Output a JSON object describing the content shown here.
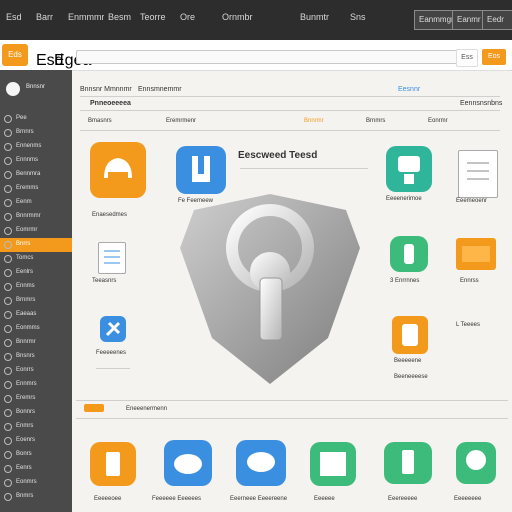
{
  "topbar": {
    "items": [
      "Esd",
      "Barr",
      "Enmmmr",
      "Besm",
      "Teorre",
      "Ore",
      "Ornmbr",
      "Bunmtr",
      "Sns"
    ],
    "buttons": [
      "Eanmmgr",
      "Eanmr",
      "Eedr"
    ]
  },
  "header": {
    "logo": "Eds",
    "link1": "Esd",
    "link2": "Egea",
    "search_value": "",
    "btn_ghost": "Ess",
    "btn_primary": "Eos"
  },
  "sidebar": {
    "username": "Bnnsnr",
    "items": [
      {
        "label": "Pee",
        "active": false
      },
      {
        "label": "Brnnrs",
        "active": false
      },
      {
        "label": "Ennenms",
        "active": false
      },
      {
        "label": "Ennnms",
        "active": false
      },
      {
        "label": "Bennmra",
        "active": false
      },
      {
        "label": "Eremms",
        "active": false
      },
      {
        "label": "Eenm",
        "active": false
      },
      {
        "label": "Bnnrmmr",
        "active": false
      },
      {
        "label": "Eomrmr",
        "active": false
      },
      {
        "label": "Bnrrs",
        "active": true
      },
      {
        "label": "Tomcs",
        "active": false
      },
      {
        "label": "Eenlrs",
        "active": false
      },
      {
        "label": "Ennms",
        "active": false
      },
      {
        "label": "Brnmrs",
        "active": false
      },
      {
        "label": "Eaeaas",
        "active": false
      },
      {
        "label": "Eonmms",
        "active": false
      },
      {
        "label": "Bnnrmr",
        "active": false
      },
      {
        "label": "Bnsnrs",
        "active": false
      },
      {
        "label": "Eonrrs",
        "active": false
      },
      {
        "label": "Ennmrs",
        "active": false
      },
      {
        "label": "Eremrs",
        "active": false
      },
      {
        "label": "Bonnrs",
        "active": false
      },
      {
        "label": "Enmrs",
        "active": false
      },
      {
        "label": "Eoenrs",
        "active": false
      },
      {
        "label": "Bonrs",
        "active": false
      },
      {
        "label": "Eenrs",
        "active": false
      },
      {
        "label": "Eonmrs",
        "active": false
      },
      {
        "label": "Bnmrs",
        "active": false
      }
    ]
  },
  "main": {
    "crumb1": "Bnnsnr Mmnnmr",
    "crumb2": "Ennsmnemmr",
    "crumb3": "Eesnnr",
    "crumb4": "Eennsnsnbns",
    "section_title": "Pnneoeeeea",
    "tabs": [
      "Bmasnrs",
      "Eremrmenr",
      "Bnnrmr",
      "Brnmrs",
      "Eonrmr"
    ],
    "big_title": "Eescweed Teesd",
    "app_labels": {
      "app1": "Enaesedmes",
      "app2": "Fe Feemeew",
      "app3": "Eeeenerimoe",
      "app4": "Eeemeoenr",
      "app5": "Teeasnrs",
      "app6": "Feeeeenes",
      "app7": "Eeeeeeees",
      "app8": "3 Enrrnnes",
      "app9": "Ennrss",
      "app10": "Beeeeene",
      "app11": "Beeneeeese",
      "app12": "L Teeees"
    },
    "bottom_label": "Eneeenermenn",
    "bottom_apps": [
      "Eeeeeoee",
      "Feeeeee Eeeeees",
      "Eeerneee Eeeereene",
      "Eeeeee",
      "Eeereeeee",
      "Eeeeeeee"
    ]
  },
  "colors": {
    "accent": "#f39a1c",
    "sidebar_bg": "#4a4a4a",
    "topbar_bg": "#2d2d2d",
    "tile_blue": "#3b8fe0",
    "tile_green": "#3dbb7a",
    "tile_teal": "#2eb59a"
  }
}
